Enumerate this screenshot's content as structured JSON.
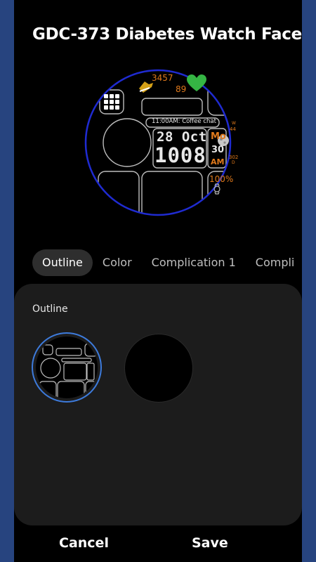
{
  "header": {
    "title": "GDC-373 Diabetes Watch Face"
  },
  "watch_preview": {
    "steps": "3457",
    "heart_rate": "89",
    "event": "11:00AM: Coffee chat",
    "date": "28 Oct",
    "time": "1008",
    "weekday": "Mo",
    "seconds": "30",
    "ampm": "AM",
    "week_label": "W",
    "week_number": "44",
    "day_of_year": "302",
    "day_of_year_unit": "D",
    "battery": "100%",
    "accent_color": "#e07a1c",
    "ring_color": "#1f2bd1"
  },
  "tabs": [
    {
      "label": "Outline",
      "active": true
    },
    {
      "label": "Color",
      "active": false
    },
    {
      "label": "Complication 1",
      "active": false
    },
    {
      "label": "Compli",
      "active": false
    }
  ],
  "panel": {
    "label": "Outline"
  },
  "options": [
    {
      "name": "outline-shapes",
      "selected": true
    },
    {
      "name": "no-outline",
      "selected": false
    }
  ],
  "footer": {
    "cancel_label": "Cancel",
    "save_label": "Save"
  },
  "colors": {
    "selection": "#3d7bdc",
    "frame": "#27447f",
    "panel": "#1c1c1c"
  }
}
